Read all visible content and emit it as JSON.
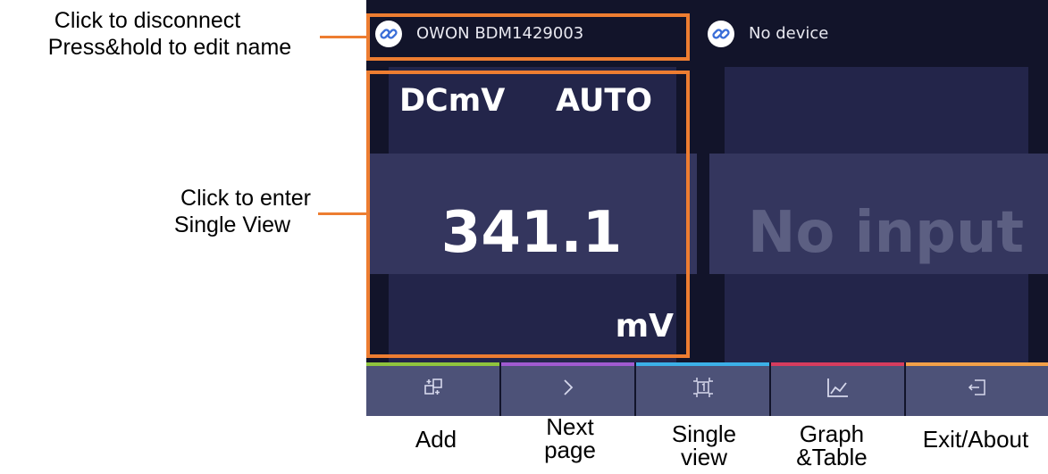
{
  "annotations": {
    "device_hint_line1": "Click to disconnect",
    "device_hint_line2": "Press&hold to edit name",
    "view_hint_line1": "Click to enter",
    "view_hint_line2": "Single View"
  },
  "devices": [
    {
      "name": "OWON BDM1429003",
      "icon": "link-icon"
    },
    {
      "name": "No device",
      "icon": "link-icon"
    }
  ],
  "meter": {
    "mode": "DCmV",
    "range": "AUTO",
    "value": "341.1",
    "unit": "mV"
  },
  "empty_panel": {
    "message": "No input"
  },
  "toolbar": {
    "buttons": [
      {
        "icon": "add-icon",
        "label": "Add",
        "accent": "#8fc43d"
      },
      {
        "icon": "chevron-right-icon",
        "label_line1": "Next",
        "label_line2": "page",
        "accent": "#a05ad0"
      },
      {
        "icon": "single-view-icon",
        "label_line1": "Single",
        "label_line2": "view",
        "accent": "#3cb0e8"
      },
      {
        "icon": "graph-icon",
        "label_line1": "Graph",
        "label_line2": "&Table",
        "accent": "#d63c5e"
      },
      {
        "icon": "exit-icon",
        "label": "Exit/About",
        "accent": "#f2a048"
      }
    ]
  },
  "colors": {
    "annotation": "#ed7d31",
    "screen_bg": "#12142a",
    "panel": "#23254a",
    "band": "#34365e",
    "toolbar": "#4d5278"
  }
}
